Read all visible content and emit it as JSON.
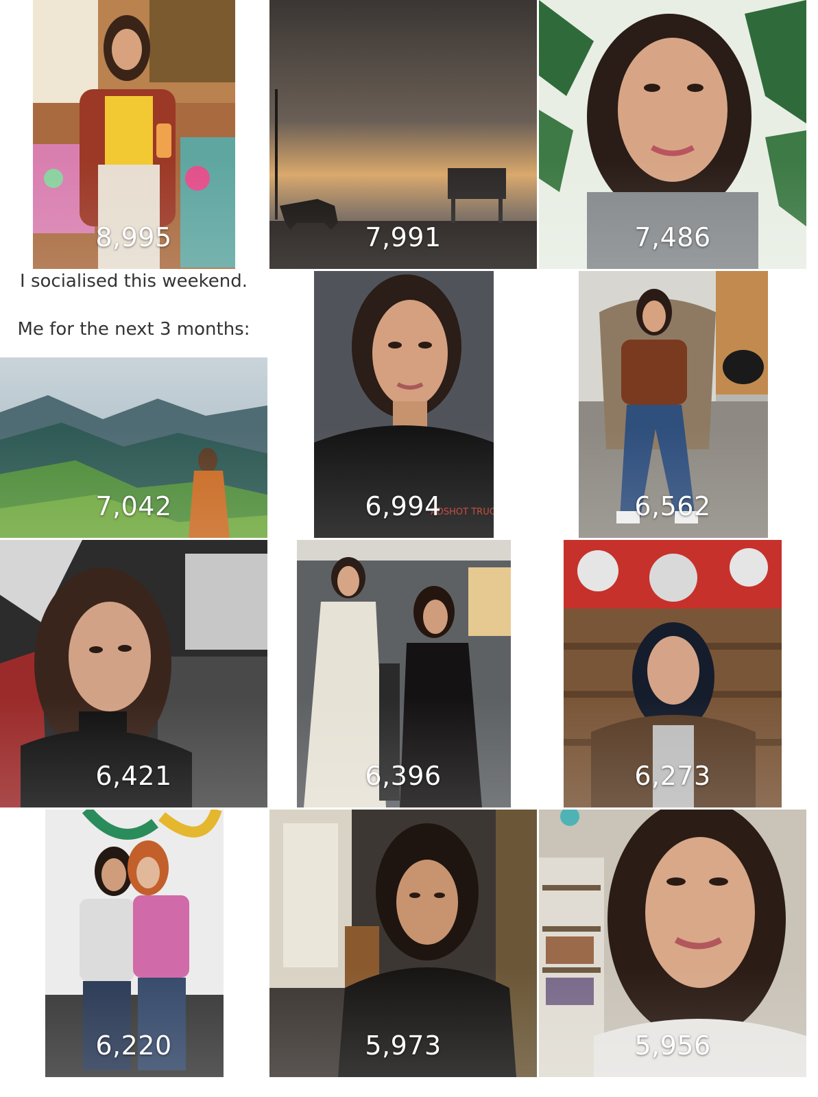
{
  "grid": {
    "tiles": [
      {
        "count": "8,995",
        "subject": "woman in yellow top holding drink"
      },
      {
        "count": "7,991",
        "subject": "horse and lifeguard tower at stormy beach"
      },
      {
        "count": "7,486",
        "subject": "selfie with palm leaf wallpaper"
      },
      {
        "count": "7,042",
        "subject": "monk overlooking green mountains",
        "caption_line1": "I socialised this weekend.",
        "caption_line2": "Me for the next 3 months:"
      },
      {
        "count": "6,994",
        "subject": "studio headshot",
        "watermark": "ADSHOT TRUCK"
      },
      {
        "count": "6,562",
        "subject": "woman sitting in wicker chair"
      },
      {
        "count": "6,421",
        "subject": "selfie against graffiti wall"
      },
      {
        "count": "6,396",
        "subject": "two women in vintage dresses"
      },
      {
        "count": "6,273",
        "subject": "woman in front of wood and red floral wall"
      },
      {
        "count": "6,220",
        "subject": "two friends hugging outdoors"
      },
      {
        "count": "5,973",
        "subject": "woman in black top indoors"
      },
      {
        "count": "5,956",
        "subject": "selfie in front of bookshelf"
      }
    ]
  }
}
